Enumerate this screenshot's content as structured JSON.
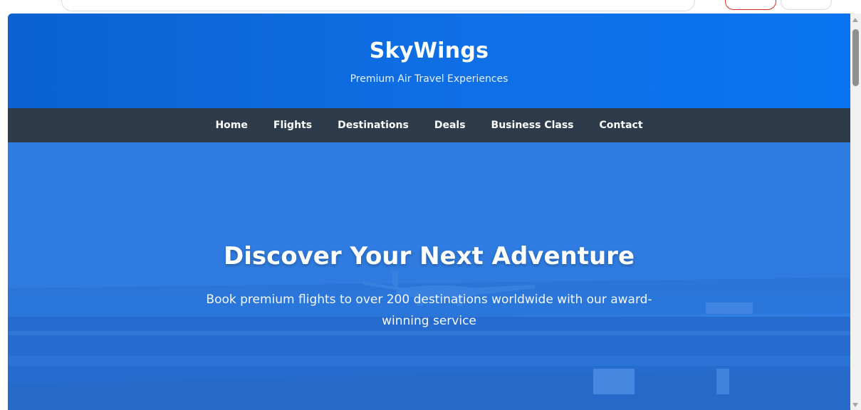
{
  "header": {
    "title": "SkyWings",
    "tagline": "Premium Air Travel Experiences"
  },
  "nav": {
    "items": [
      {
        "label": "Home"
      },
      {
        "label": "Flights"
      },
      {
        "label": "Destinations"
      },
      {
        "label": "Deals"
      },
      {
        "label": "Business Class"
      },
      {
        "label": "Contact"
      }
    ]
  },
  "hero": {
    "title": "Discover Your Next Adventure",
    "text": "Book premium flights to over 200 destinations worldwide with our award-winning service"
  },
  "colors": {
    "header_blue": "#0f6fe6",
    "nav_dark": "#2e3b4a",
    "hero_blue": "#2e7be0",
    "text_white": "#ffffff"
  },
  "icons": {
    "scroll_up": "scroll-up-arrow-icon",
    "scroll_down": "scroll-down-arrow-icon"
  }
}
